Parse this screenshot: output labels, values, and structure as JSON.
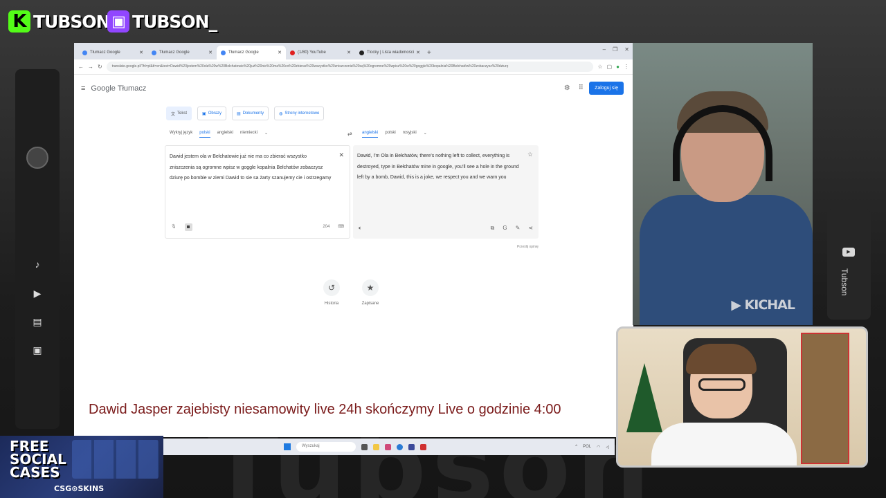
{
  "overlay": {
    "kick_name": "TUBSON",
    "kick_icon": "K",
    "twitch_name": "TUBSON_",
    "twitch_icon": "▣",
    "bg_word": "Tubson",
    "side_channel": "Tubson",
    "cam_watermark": "KICHAL",
    "ticker_text": "Dawid Jasper zajebisty niesamowity live 24h skończymy Live o godzinie 4:00",
    "promo_line1": "FREE",
    "promo_line2": "SOCIAL",
    "promo_line3": "CASES",
    "promo_brand": "CSG⊙SKINS"
  },
  "browser": {
    "tabs": [
      "Tłumacz Google",
      "Tłumacz Google",
      "Tłumacz Google",
      "(1/80) YouTube",
      "Tlocky | Lista wiadomości"
    ],
    "url": "translate.google.pl/?hl=pl&tl=en&text=Dawid%20jestem%20ola%20w%20Bełchatowie%20już%20nie%20ma%20co%20zbierać%20wszystko%20zniszczenia%20są%20ogromne%20wpisz%20w%20goggle%20kopalnia%20Bełchatów%20zobaczysz%20dziurę"
  },
  "gt": {
    "logo_google": "Google",
    "logo_product": "Tłumacz",
    "login": "Zaloguj się",
    "modes": [
      "Tekst",
      "Obrazy",
      "Dokumenty",
      "Strony internetowe"
    ],
    "src_langs": [
      "Wykryj język",
      "polski",
      "angielski",
      "niemiecki"
    ],
    "tgt_langs": [
      "angielski",
      "polski",
      "rosyjski"
    ],
    "source_text": "Dawid jestem ola w Bełchatowie już nie ma co zbierać wszystko zniszczenia są ogromne wpisz w goggle kopalnia Bełchatów zobaczysz dziurę po bombie w ziemi Dawid to sie sa żarty szanujemy cie i ostrzegamy",
    "char_count": "204",
    "target_text": "Dawid, I'm Ola in Bełchatów, there's nothing left to collect, everything is destroyed, type in Bełchatów mine in google, you'll see a hole in the ground left by a bomb, Dawid, this is a joke, we respect you and we warn you",
    "feedback": "Prześlij opinię",
    "history": "Historia",
    "saved": "Zapisane"
  },
  "taskbar": {
    "search": "Wyszukaj",
    "lang": "POL"
  }
}
